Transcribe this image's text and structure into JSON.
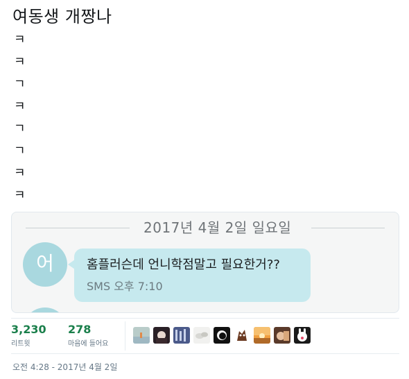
{
  "tweet": {
    "text_title": "여동생 개짱나",
    "text_lines": [
      "ㅋ",
      "ㅋ",
      "ㄱ",
      "ㅋ",
      "ㄱ",
      "ㄱ",
      "ㅋ",
      "ㅋ"
    ]
  },
  "media": {
    "date_label": "2017년 4월 2일 일요일",
    "avatar_initial": "어",
    "message_text": "홈플러슨데 언니학점말고 필요한거??",
    "message_meta": "SMS 오후 7:10"
  },
  "stats": {
    "retweets_count": "3,230",
    "retweets_label": "리트윗",
    "likes_count": "278",
    "likes_label": "마음에 들어요"
  },
  "liker_avatars": [
    {
      "name": "liker-avatar-1",
      "color": "#b9ccc9"
    },
    {
      "name": "liker-avatar-2",
      "color": "#2a2026"
    },
    {
      "name": "liker-avatar-3",
      "color": "#4b5a8a"
    },
    {
      "name": "liker-avatar-4",
      "color": "#f1f1ef"
    },
    {
      "name": "liker-avatar-5",
      "color": "#111111"
    },
    {
      "name": "liker-avatar-6",
      "color": "#6b3a22"
    },
    {
      "name": "liker-avatar-7",
      "color": "#f0a040"
    },
    {
      "name": "liker-avatar-8",
      "color": "#5a3a2a"
    },
    {
      "name": "liker-avatar-9",
      "color": "#1a1a1a"
    }
  ],
  "timestamp": "오전 4:28 - 2017년 4월 2일"
}
